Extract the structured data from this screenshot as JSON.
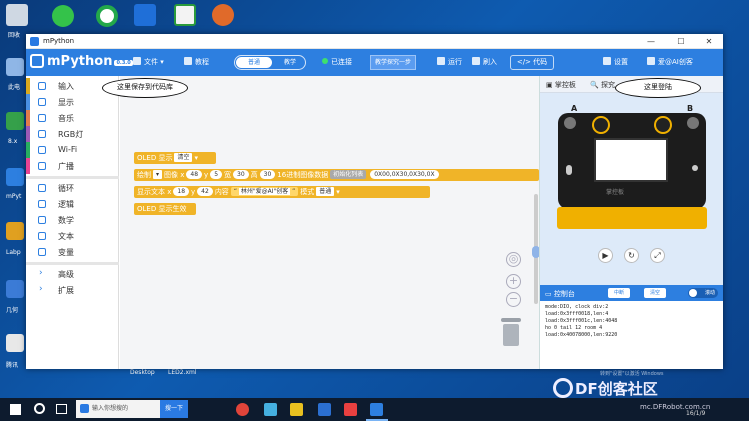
{
  "desktop": {
    "icons": [
      {
        "label": "回收",
        "name": "recycle-bin-icon"
      },
      {
        "label": "",
        "name": "wechat-icon"
      },
      {
        "label": "",
        "name": "browser-icon"
      },
      {
        "label": "",
        "name": "edge-icon"
      },
      {
        "label": "",
        "name": "wps-sheet-icon"
      },
      {
        "label": "",
        "name": "monkey-app-icon"
      }
    ],
    "side_labels": [
      "此电",
      "8.x",
      "mPyt",
      "Labp",
      "几何",
      "腾讯"
    ],
    "file_labels": [
      "Desktop",
      "LED2.xml"
    ]
  },
  "window": {
    "title": "mPython",
    "controls": [
      "—",
      "☐",
      "✕"
    ]
  },
  "appbar": {
    "logo": "mPython",
    "version": "0.3.0",
    "file": "文件",
    "tutorial": "教程",
    "mode_normal": "普通",
    "mode_teach": "教学",
    "connected": "已连接",
    "explore": "教学探究一步",
    "run": "运行",
    "flash": "刷入",
    "code": "代码",
    "settings": "设置",
    "user": "爱@AI创客"
  },
  "categories": [
    {
      "label": "输入",
      "color": "#d9a91d"
    },
    {
      "label": "显示",
      "color": "#4a90e2"
    },
    {
      "label": "音乐",
      "color": "#e27c4a"
    },
    {
      "label": "RGB灯",
      "color": "#9b59b6"
    },
    {
      "label": "Wi-Fi",
      "color": "#27ae60"
    },
    {
      "label": "广播",
      "color": "#e84393"
    },
    {
      "label": "循环",
      "color": "#2d7fe0"
    },
    {
      "label": "逻辑",
      "color": "#2d7fe0"
    },
    {
      "label": "数学",
      "color": "#2d7fe0"
    },
    {
      "label": "文本",
      "color": "#2d7fe0"
    },
    {
      "label": "变量",
      "color": "#2d7fe0"
    },
    {
      "label": "高级",
      "color": "#2d7fe0"
    },
    {
      "label": "扩展",
      "color": "#2d7fe0"
    }
  ],
  "blocks": {
    "b1_label": "OLED 显示",
    "b1_value": "清空",
    "b2_label": "绘制",
    "b2_shape": "图像 x",
    "b2_x": "48",
    "b2_y_label": "y",
    "b2_y": "5",
    "b2_w_label": "宽",
    "b2_w": "30",
    "b2_h_label": "高",
    "b2_h": "30",
    "b2_data_label": "16进制图像数据",
    "b2_init": "初始化列表",
    "b2_data": "0X00,0X30,0X30,0X",
    "b3_label": "显示文本 x",
    "b3_x": "18",
    "b3_y_label": "y",
    "b3_y": "42",
    "b3_content_label": "内容",
    "b3_text": "林州\"爱@AI\"创客",
    "b3_mode_label": "模式",
    "b3_mode": "普通",
    "b4_label": "OLED 显示生效"
  },
  "right_panel": {
    "tab_panel": "掌控板",
    "tab_explore": "探究",
    "board_brand": "掌控板",
    "console_title": "控制台",
    "console_clear": "中断",
    "console_reset": "清空",
    "console_toggle": "滚动",
    "console_lines": [
      "mode:DIO, clock div:2",
      "load:0x3fff0018,len:4",
      "load:0x3fff001c,len:4048",
      "ho 0 tail 12 room 4",
      "load:0x40078000,len:9220"
    ]
  },
  "callouts": {
    "save": "这里保存到代码库",
    "login": "这里登陆"
  },
  "taskbar": {
    "search_placeholder": "输入你想搜的",
    "search_button": "搜一下",
    "clock": "16/1/9"
  },
  "watermark": {
    "activate_title": "激活 Windows",
    "activate_sub": "转到\"设置\"以激活 Windows",
    "brand": "DF创客社区",
    "url": "mc.DFRobot.com.cn"
  }
}
